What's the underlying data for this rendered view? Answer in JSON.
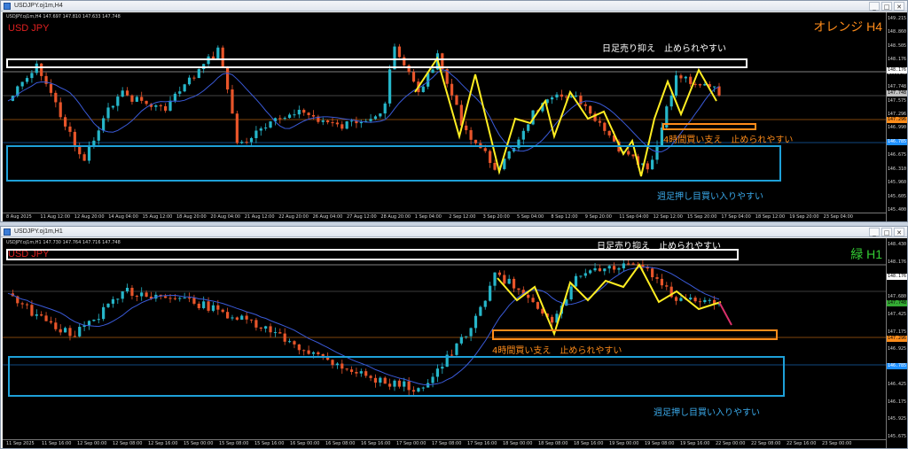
{
  "windows": [
    {
      "id": "w1",
      "title": "USDJPY.oj1m,H4",
      "info_bar": "USDJPY.oj1m,H4  147.697 147.810 147.633 147.748",
      "symbol_label": "USD JPY",
      "timeframe_label": "オレンジ H4",
      "timeframe_color": "#ff8c1a",
      "price_ticks": [
        "149.215",
        "148.860",
        "148.505",
        "148.176",
        "147.940",
        "147.748",
        "147.575",
        "147.296",
        "146.990",
        "146.785",
        "146.675",
        "146.310",
        "145.960",
        "145.605",
        "145.400"
      ],
      "price_tags": [
        {
          "label": "148.176",
          "bg": "#ffffff",
          "fg": "#000000"
        },
        {
          "label": "147.748",
          "bg": "#c0c0c0",
          "fg": "#000000"
        },
        {
          "label": "147.296",
          "bg": "#ff8c1a",
          "fg": "#000000"
        },
        {
          "label": "146.785",
          "bg": "#1e90ff",
          "fg": "#ffffff"
        }
      ],
      "time_labels": [
        "8 Aug 2025",
        "11 Aug 12:00",
        "12 Aug 20:00",
        "14 Aug 04:00",
        "15 Aug 12:00",
        "18 Aug 20:00",
        "20 Aug 04:00",
        "21 Aug 12:00",
        "22 Aug 20:00",
        "26 Aug 04:00",
        "27 Aug 12:00",
        "28 Aug 20:00",
        "1 Sep 04:00",
        "2 Sep 12:00",
        "3 Sep 20:00",
        "5 Sep 04:00",
        "8 Sep 12:00",
        "9 Sep 20:00",
        "11 Sep 04:00",
        "12 Sep 12:00",
        "15 Sep 20:00",
        "17 Sep 04:00",
        "18 Sep 12:00",
        "19 Sep 20:00",
        "23 Sep 04:00"
      ],
      "annotations": {
        "resistance": "日足売り抑え　止められやすい",
        "support4h": "4時間買い支え　止められやすい",
        "weekly": "週足押し目買い入りやすい"
      }
    },
    {
      "id": "w2",
      "title": "USDJPY.oj1m,H1",
      "info_bar": "USDJPY.oj1m,H1  147.730 147.764 147.716 147.748",
      "symbol_label": "USD JPY",
      "timeframe_label": "緑 H1",
      "timeframe_color": "#33cc33",
      "price_ticks": [
        "148.430",
        "148.176",
        "147.930",
        "147.680",
        "147.425",
        "147.175",
        "146.925",
        "146.785",
        "146.425",
        "146.175",
        "145.925",
        "145.675"
      ],
      "price_tags": [
        {
          "label": "148.176",
          "bg": "#ffffff",
          "fg": "#000000"
        },
        {
          "label": "147.748",
          "bg": "#33aa33",
          "fg": "#000000"
        },
        {
          "label": "147.296",
          "bg": "#ff8c1a",
          "fg": "#000000"
        },
        {
          "label": "146.785",
          "bg": "#1e90ff",
          "fg": "#ffffff"
        }
      ],
      "time_labels": [
        "11 Sep 2025",
        "11 Sep 16:00",
        "12 Sep 00:00",
        "12 Sep 08:00",
        "12 Sep 16:00",
        "15 Sep 00:00",
        "15 Sep 08:00",
        "15 Sep 16:00",
        "16 Sep 00:00",
        "16 Sep 08:00",
        "16 Sep 16:00",
        "17 Sep 00:00",
        "17 Sep 08:00",
        "17 Sep 16:00",
        "18 Sep 00:00",
        "18 Sep 08:00",
        "18 Sep 16:00",
        "19 Sep 00:00",
        "19 Sep 08:00",
        "19 Sep 16:00",
        "22 Sep 00:00",
        "22 Sep 08:00",
        "22 Sep 16:00",
        "23 Sep 00:00"
      ],
      "annotations": {
        "resistance": "日足売り抑え　止められやすい",
        "support4h": "4時間買い支え　止められやすい",
        "weekly": "週足押し目買い入りやすい"
      }
    }
  ],
  "window_buttons": {
    "minimize": "_",
    "maximize": "□",
    "close": "✕"
  },
  "colors": {
    "bull": "#26b6c9",
    "bear": "#e8552a",
    "ma": "#3a5ad8",
    "zigzag": "#ffee22",
    "resistance_box": "#ffffff",
    "support_box": "#ff8c1a",
    "weekly_box": "#1ea0d8",
    "weekly_text": "#3aa8e8",
    "support_text": "#ff8c1a",
    "resistance_text": "#ffffff",
    "forecast": "#d8306a"
  }
}
